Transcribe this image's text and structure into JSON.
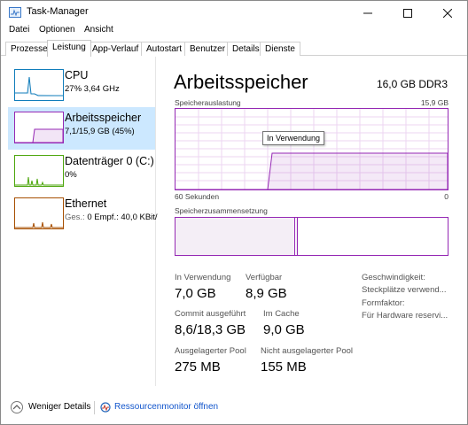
{
  "window": {
    "title": "Task-Manager"
  },
  "menu": [
    "Datei",
    "Optionen",
    "Ansicht"
  ],
  "tabs": [
    {
      "label": "Prozesse",
      "active": false
    },
    {
      "label": "Leistung",
      "active": true
    },
    {
      "label": "App-Verlauf",
      "active": false
    },
    {
      "label": "Autostart",
      "active": false
    },
    {
      "label": "Benutzer",
      "active": false
    },
    {
      "label": "Details",
      "active": false
    },
    {
      "label": "Dienste",
      "active": false
    }
  ],
  "resources": [
    {
      "name": "CPU",
      "sub": "27%  3,64 GHz",
      "color": "#117dbb",
      "selected": false
    },
    {
      "name": "Arbeitsspeicher",
      "sub": "7,1/15,9 GB (45%)",
      "color": "#9528b4",
      "selected": true
    },
    {
      "name": "Datenträger 0 (C:)",
      "sub": "0%",
      "color": "#4da60c",
      "selected": false
    },
    {
      "name": "Ethernet",
      "sub_label": "Ges.:",
      "sub_value": "0  Empf.: 40,0 KBit/",
      "color": "#a74f01",
      "selected": false
    }
  ],
  "main": {
    "title": "Arbeitsspeicher",
    "spec": "16,0 GB DDR3",
    "usage_label": "Speicherauslastung",
    "usage_max": "15,9 GB",
    "time_label": "60 Sekunden",
    "time_min": "0",
    "tooltip": "In Verwendung",
    "composition_label": "Speicherzusammensetzung",
    "usage_fraction": 0.45
  },
  "stats": {
    "in_use": {
      "label": "In Verwendung",
      "value": "7,0 GB"
    },
    "available": {
      "label": "Verfügbar",
      "value": "8,9 GB"
    },
    "committed": {
      "label": "Commit ausgeführt",
      "value": "8,6/18,3 GB"
    },
    "cached": {
      "label": "Im Cache",
      "value": "9,0 GB"
    },
    "paged": {
      "label": "Ausgelagerter Pool",
      "value": "275 MB"
    },
    "nonpaged": {
      "label": "Nicht ausgelagerter Pool",
      "value": "155 MB"
    }
  },
  "side_info": [
    "Geschwindigkeit:",
    "Steckplätze verwend...",
    "Formfaktor:",
    "Für Hardware reservi..."
  ],
  "footer": {
    "less_details": "Weniger Details",
    "resource_monitor": "Ressourcenmonitor öffnen"
  }
}
